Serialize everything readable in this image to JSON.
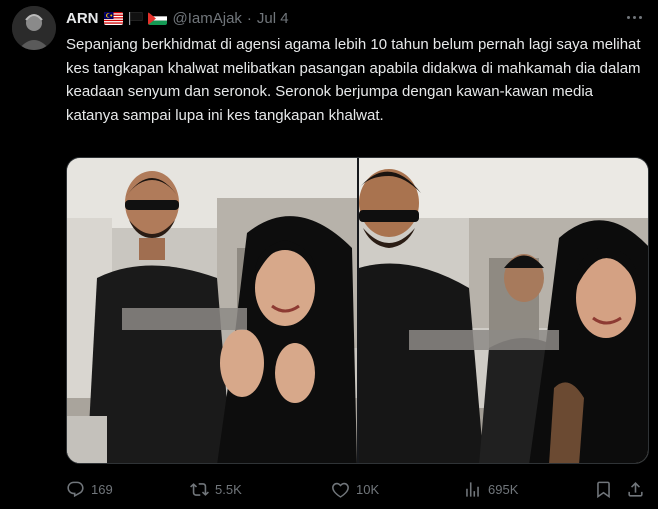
{
  "author": {
    "name": "ARN",
    "flags": [
      "malaysia-flag",
      "black-flag",
      "palestine-flag"
    ],
    "handle": "@IamAjak",
    "separator": "·",
    "date": "Jul 4"
  },
  "tweet": {
    "text": "Sepanjang berkhidmat di agensi agama lebih 10 tahun belum pernah lagi saya melihat kes tangkapan khalwat melibatkan pasangan apabila didakwa di mahkamah dia dalam keadaan senyum dan seronok. Seronok berjumpa dengan kawan-kawan media katanya sampai lupa ini kes tangkapan khalwat."
  },
  "media": {
    "type": "image",
    "frames": [
      "left-frame",
      "right-frame"
    ]
  },
  "actions": {
    "replies": "169",
    "reposts": "5.5K",
    "likes": "10K",
    "views": "695K"
  },
  "colors": {
    "background": "#000000",
    "text": "#e7e9ea",
    "muted": "#71767b",
    "border": "#2f3336"
  },
  "icons": {
    "reply": "reply-icon",
    "repost": "repost-icon",
    "like": "heart-icon",
    "views": "views-icon",
    "bookmark": "bookmark-icon",
    "share": "share-icon",
    "more": "more-icon"
  }
}
